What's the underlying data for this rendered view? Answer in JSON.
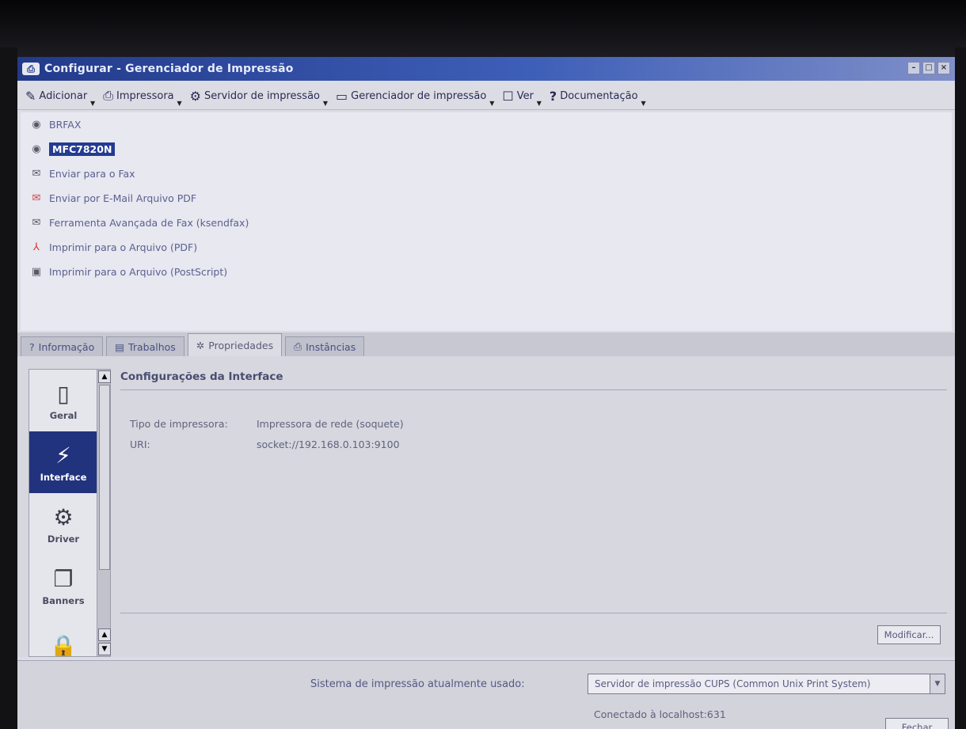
{
  "window": {
    "title": "Configurar - Gerenciador de Impressão"
  },
  "toolbar": {
    "items": [
      {
        "label": "Adicionar",
        "icon": "wand-icon"
      },
      {
        "label": "Impressora",
        "icon": "printer-icon"
      },
      {
        "label": "Servidor de impressão",
        "icon": "server-icon"
      },
      {
        "label": "Gerenciador de impressão",
        "icon": "window-icon"
      },
      {
        "label": "Ver",
        "icon": "view-icon"
      },
      {
        "label": "Documentação",
        "icon": "help-icon"
      }
    ]
  },
  "printers": [
    {
      "label": "BRFAX",
      "icon": "printer-icon"
    },
    {
      "label": "MFC7820N",
      "icon": "printer-icon",
      "selected": true
    },
    {
      "label": "Enviar para o Fax",
      "icon": "fax-icon"
    },
    {
      "label": "Enviar por E-Mail Arquivo PDF",
      "icon": "email-pdf-icon"
    },
    {
      "label": "Ferramenta Avançada de Fax (ksendfax)",
      "icon": "fax-tool-icon"
    },
    {
      "label": "Imprimir para o Arquivo (PDF)",
      "icon": "pdf-icon"
    },
    {
      "label": "Imprimir para o Arquivo (PostScript)",
      "icon": "floppy-icon"
    }
  ],
  "tabs": [
    {
      "label": "Informação"
    },
    {
      "label": "Trabalhos"
    },
    {
      "label": "Propriedades",
      "active": true
    },
    {
      "label": "Instâncias"
    }
  ],
  "sidebar": {
    "items": [
      {
        "label": "Geral"
      },
      {
        "label": "Interface",
        "active": true
      },
      {
        "label": "Driver"
      },
      {
        "label": "Banners"
      }
    ]
  },
  "panel": {
    "title": "Configurações da Interface",
    "fields": [
      {
        "key": "Tipo de impressora:",
        "value": "Impressora de rede (soquete)"
      },
      {
        "key": "URI:",
        "value": "socket://192.168.0.103:9100"
      }
    ],
    "modify_label": "Modificar..."
  },
  "status": {
    "system_label": "Sistema de impressão atualmente usado:",
    "system_value": "Servidor de impressão CUPS (Common Unix Print System)",
    "connected": "Conectado à localhost:631",
    "close_label": "Fechar"
  }
}
